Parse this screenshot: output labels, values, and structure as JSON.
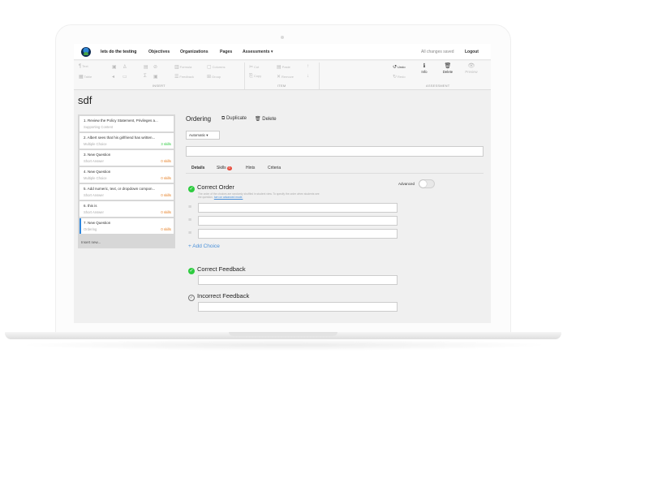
{
  "nav": {
    "brand": "lets do the testing",
    "links": [
      "Objectives",
      "Organizations",
      "Pages",
      "Assessments ▾"
    ],
    "status": "All changes saved",
    "logout": "Logout"
  },
  "toolbar": {
    "insert_items": [
      "Text",
      "Table",
      "Header",
      "Paragraph",
      "Quote",
      "Link",
      "Image",
      "Audio",
      "Video",
      "Code",
      "Formula",
      "Columns",
      "Feedback",
      "Group"
    ],
    "item_items": [
      "Cut",
      "Copy",
      "Paste",
      "Remove"
    ],
    "groups": [
      "INSERT",
      "ITEM",
      "ASSESSMENT"
    ],
    "undo": "Undo",
    "redo": "Redo",
    "info": "Info",
    "delete": "Delete",
    "preview": "Preview"
  },
  "page": {
    "title": "sdf"
  },
  "questions": [
    {
      "title": "1. Review the Policy Statement, Privileges a...",
      "type": "Supporting Content",
      "skills": ""
    },
    {
      "title": "2. Albert sees that his girlfriend has written...",
      "type": "Multiple Choice",
      "skills": "3 skills"
    },
    {
      "title": "3. New Question",
      "type": "Short Answer",
      "skills": "0 skills"
    },
    {
      "title": "4. New Question",
      "type": "Multiple Choice",
      "skills": "0 skills"
    },
    {
      "title": "5. Add numeric, text, or dropdown compon...",
      "type": "Short Answer",
      "skills": "0 skills"
    },
    {
      "title": "6. this is",
      "type": "Short Answer",
      "skills": "0 skills"
    },
    {
      "title": "7. New Question",
      "type": "Ordering",
      "skills": "0 skills"
    }
  ],
  "insert_new": "Insert new...",
  "editor": {
    "title": "Ordering",
    "duplicate": "Duplicate",
    "delete": "Delete",
    "select_value": "Automatic ▾",
    "tabs": {
      "details": "Details",
      "skills": "Skills",
      "skills_count": "0",
      "hints": "Hints",
      "criteria": "Criteria"
    },
    "advanced": "Advanced",
    "correct_order": "Correct Order",
    "help_text": "The order of the choices are randomly shuffled in student view. To specify the order when students see the question,",
    "help_link": "turn on advanced mode.",
    "add_choice": "+ Add Choice",
    "correct_feedback": "Correct Feedback",
    "incorrect_feedback": "Incorrect Feedback"
  },
  "colors": {
    "accent": "#2e86de",
    "success": "#2ecc40",
    "badge": "#e74c3c",
    "link": "#4a90d9"
  }
}
